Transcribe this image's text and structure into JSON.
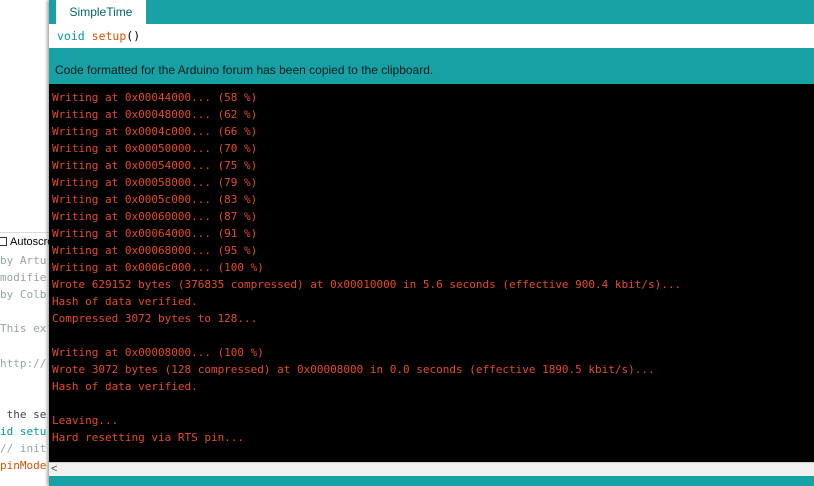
{
  "background_window": {
    "autoscroll_label": "Autoscro",
    "code_lines": [
      {
        "text": "by Artu",
        "class": "c-comment"
      },
      {
        "text": "modifie",
        "class": "c-comment"
      },
      {
        "text": "by Colb",
        "class": "c-comment"
      },
      {
        "text": "",
        "class": "c-comment"
      },
      {
        "text": "This ex",
        "class": "c-comment"
      },
      {
        "text": "",
        "class": "c-comment"
      },
      {
        "text": "http://",
        "class": "c-comment"
      },
      {
        "text": "",
        "class": "c-comment"
      },
      {
        "text": "",
        "class": "c-comment"
      },
      {
        "text": " the se",
        "class": "c-default"
      },
      {
        "text": "id setu",
        "class": "c-kw"
      },
      {
        "text": "// init",
        "class": "c-comment"
      },
      {
        "text": "pinMode",
        "class": "c-fn"
      }
    ]
  },
  "tab": {
    "label": "SimpleTime"
  },
  "editor": {
    "keyword": "void",
    "function": "setup",
    "parens": "()"
  },
  "status_message": "Code formatted for the Arduino forum has been copied to the clipboard.",
  "console": [
    "Writing at 0x00044000... (58 %)",
    "Writing at 0x00048000... (62 %)",
    "Writing at 0x0004c000... (66 %)",
    "Writing at 0x00050000... (70 %)",
    "Writing at 0x00054000... (75 %)",
    "Writing at 0x00058000... (79 %)",
    "Writing at 0x0005c000... (83 %)",
    "Writing at 0x00060000... (87 %)",
    "Writing at 0x00064000... (91 %)",
    "Writing at 0x00068000... (95 %)",
    "Writing at 0x0006c000... (100 %)",
    "Wrote 629152 bytes (376835 compressed) at 0x00010000 in 5.6 seconds (effective 900.4 kbit/s)...",
    "Hash of data verified.",
    "Compressed 3072 bytes to 128...",
    "",
    "Writing at 0x00008000... (100 %)",
    "Wrote 3072 bytes (128 compressed) at 0x00008000 in 0.0 seconds (effective 1890.5 kbit/s)...",
    "Hash of data verified.",
    "",
    "Leaving...",
    "Hard resetting via RTS pin..."
  ],
  "scroll_left_glyph": "<",
  "colors": {
    "teal": "#17a1a5",
    "console_text": "#e34c26",
    "keyword": "#00979c",
    "function": "#d35400"
  }
}
